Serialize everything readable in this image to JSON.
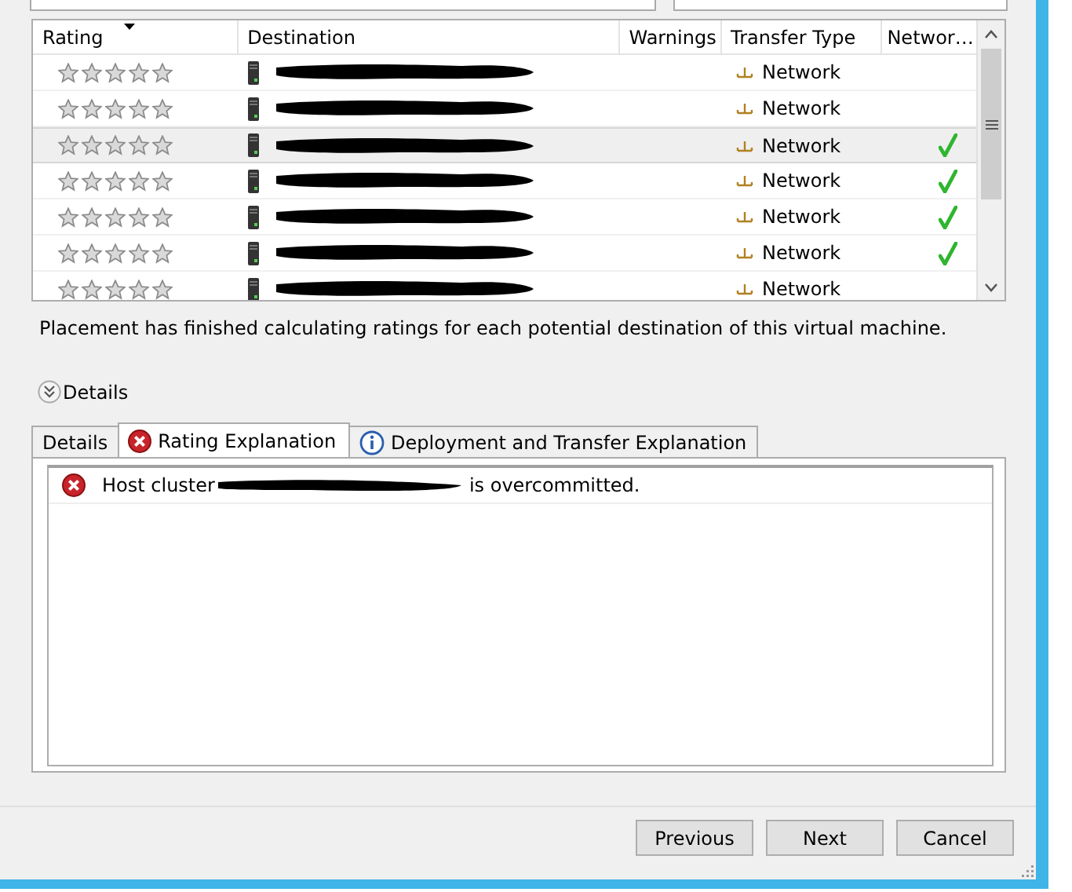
{
  "grid": {
    "columns": [
      {
        "label": "Rating",
        "sorted": true
      },
      {
        "label": "Destination",
        "sorted": false
      },
      {
        "label": "Warnings",
        "sorted": false
      },
      {
        "label": "Transfer Type",
        "sorted": false
      },
      {
        "label": "Networ…",
        "sorted": false
      }
    ],
    "rows": [
      {
        "stars": 0,
        "transfer": "Network",
        "selected": false,
        "network_ok": false
      },
      {
        "stars": 0,
        "transfer": "Network",
        "selected": false,
        "network_ok": false
      },
      {
        "stars": 0,
        "transfer": "Network",
        "selected": true,
        "network_ok": true
      },
      {
        "stars": 0,
        "transfer": "Network",
        "selected": false,
        "network_ok": true
      },
      {
        "stars": 0,
        "transfer": "Network",
        "selected": false,
        "network_ok": true
      },
      {
        "stars": 0,
        "transfer": "Network",
        "selected": false,
        "network_ok": true
      },
      {
        "stars": 0,
        "transfer": "Network",
        "selected": false,
        "network_ok": false
      }
    ]
  },
  "status": "Placement has finished calculating ratings for each potential destination of this virtual machine.",
  "details_toggle": {
    "label": "Details",
    "expanded": true
  },
  "tabs": [
    {
      "label": "Details",
      "kind": "plain",
      "selected": false
    },
    {
      "label": "Rating Explanation",
      "kind": "error",
      "selected": true
    },
    {
      "label": "Deployment and Transfer Explanation",
      "kind": "info",
      "selected": false
    }
  ],
  "messages": [
    {
      "kind": "error",
      "before": "Host cluster",
      "after": "is overcommitted."
    }
  ],
  "buttons": [
    "Previous",
    "Next",
    "Cancel"
  ]
}
